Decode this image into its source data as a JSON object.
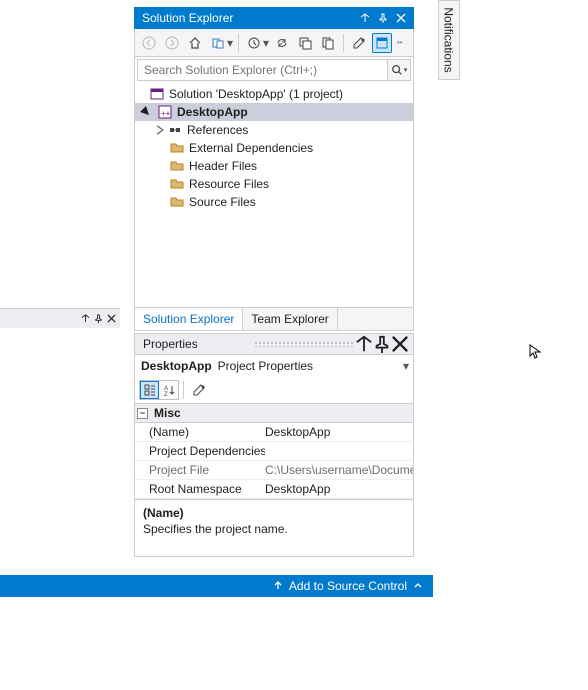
{
  "solutionExplorer": {
    "title": "Solution Explorer",
    "searchPlaceholder": "Search Solution Explorer (Ctrl+;)",
    "tree": {
      "solution": "Solution 'DesktopApp' (1 project)",
      "project": "DesktopApp",
      "items": {
        "references": "References",
        "externalDeps": "External Dependencies",
        "headerFiles": "Header Files",
        "resourceFiles": "Resource Files",
        "sourceFiles": "Source Files"
      }
    },
    "tabs": {
      "solutionExplorer": "Solution Explorer",
      "teamExplorer": "Team Explorer"
    }
  },
  "properties": {
    "title": "Properties",
    "contextName": "DesktopApp",
    "contextType": "Project Properties",
    "category": "Misc",
    "rows": {
      "nameKey": "(Name)",
      "nameVal": "DesktopApp",
      "depsKey": "Project Dependencies",
      "depsVal": "",
      "fileKey": "Project File",
      "fileVal": "C:\\Users\\username\\Documents\\...",
      "nsKey": "Root Namespace",
      "nsVal": "DesktopApp"
    },
    "desc": {
      "title": "(Name)",
      "body": "Specifies the project name."
    }
  },
  "status": {
    "sourceControl": "Add to Source Control"
  },
  "sideTab": "Notifications"
}
